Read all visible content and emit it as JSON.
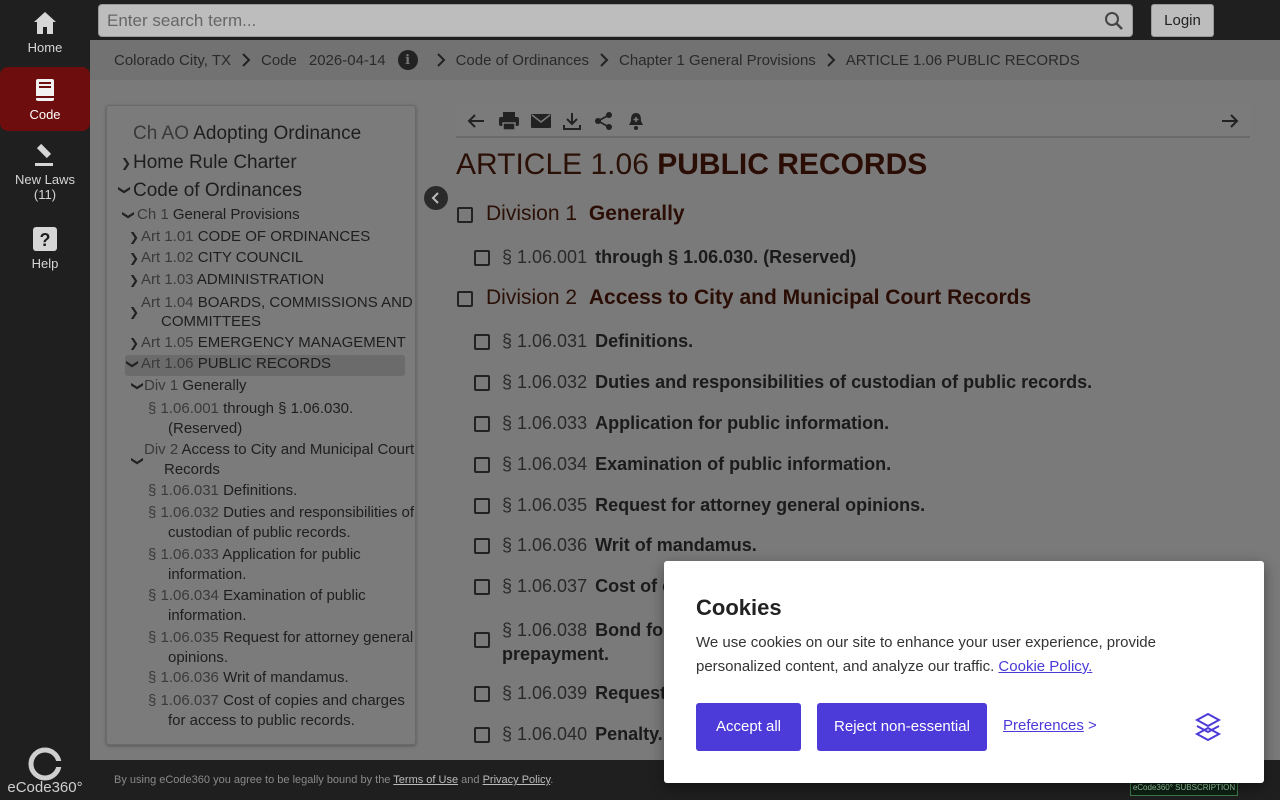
{
  "rail": {
    "home_label": "Home",
    "code_label": "Code",
    "new_laws_label": "New Laws",
    "new_laws_count": "(11)",
    "help_label": "Help",
    "logo_text": "eCode360°"
  },
  "search": {
    "placeholder": "Enter search term...",
    "login_label": "Login"
  },
  "breadcrumb": {
    "items": [
      "Colorado City, TX",
      "Code",
      "Code of Ordinances",
      "Chapter 1 General Provisions",
      "ARTICLE 1.06 PUBLIC RECORDS"
    ],
    "date": "2026-04-14",
    "info_glyph": "i"
  },
  "toc": {
    "ch_ao_pre": "Ch AO",
    "ch_ao_label": "Adopting Ordinance",
    "home_rule": "Home Rule Charter",
    "code_ord": "Code of Ordinances",
    "ch1_pre": "Ch 1",
    "ch1_label": "General Provisions",
    "articles": [
      {
        "pre": "Art 1.01",
        "label": "CODE OF ORDINANCES"
      },
      {
        "pre": "Art 1.02",
        "label": "CITY COUNCIL"
      },
      {
        "pre": "Art 1.03",
        "label": "ADMINISTRATION"
      },
      {
        "pre": "Art 1.04",
        "label": "BOARDS, COMMISSIONS AND",
        "label2": "COMMITTEES"
      },
      {
        "pre": "Art 1.05",
        "label": "EMERGENCY MANAGEMENT"
      },
      {
        "pre": "Art 1.06",
        "label": "PUBLIC RECORDS"
      }
    ],
    "div1_pre": "Div 1",
    "div1_label": "Generally",
    "div1_sec_pre": "§ 1.06.001",
    "div1_sec_label": "through § 1.06.030.",
    "div1_sec_label2": "(Reserved)",
    "div2_pre": "Div 2",
    "div2_label": "Access to City and Municipal Court",
    "div2_label2": "Records",
    "sections": [
      {
        "pre": "§ 1.06.031",
        "label": "Definitions."
      },
      {
        "pre": "§ 1.06.032",
        "label": "Duties and responsibilities of",
        "label2": "custodian of public records."
      },
      {
        "pre": "§ 1.06.033",
        "label": "Application for public",
        "label2": "information."
      },
      {
        "pre": "§ 1.06.034",
        "label": "Examination of public",
        "label2": "information."
      },
      {
        "pre": "§ 1.06.035",
        "label": "Request for attorney general",
        "label2": "opinions."
      },
      {
        "pre": "§ 1.06.036",
        "label": "Writ of mandamus."
      },
      {
        "pre": "§ 1.06.037",
        "label": "Cost of copies and charges",
        "label2": "for access to public records."
      }
    ]
  },
  "main": {
    "title_pre": "ARTICLE 1.06",
    "title": "PUBLIC RECORDS",
    "div1_pre": "Division 1",
    "div1_label": "Generally",
    "div1_sec_pre": "§ 1.06.001",
    "div1_sec_label": "through § 1.06.030. (Reserved)",
    "div2_pre": "Division 2",
    "div2_label": "Access to City and Municipal Court Records",
    "sections": [
      {
        "pre": "§ 1.06.031",
        "label": "Definitions."
      },
      {
        "pre": "§ 1.06.032",
        "label": "Duties and responsibilities of custodian of public records."
      },
      {
        "pre": "§ 1.06.033",
        "label": "Application for public information."
      },
      {
        "pre": "§ 1.06.034",
        "label": "Examination of public information."
      },
      {
        "pre": "§ 1.06.035",
        "label": "Request for attorney general opinions."
      },
      {
        "pre": "§ 1.06.036",
        "label": "Writ of mandamus."
      },
      {
        "pre": "§ 1.06.037",
        "label": "Cost of c"
      },
      {
        "pre": "§ 1.06.038",
        "label": "Bond for",
        "label2": "prepayment."
      },
      {
        "pre": "§ 1.06.039",
        "label": "Requests"
      },
      {
        "pre": "§ 1.06.040",
        "label": "Penalty."
      }
    ]
  },
  "footer": {
    "text_prefix": "By using eCode360 you agree to be legally bound by the",
    "terms": "Terms of Use",
    "and": "and",
    "privacy": "Privacy Policy",
    "period": ".",
    "badge": "eCode360° SUBSCRIPTION"
  },
  "cookie": {
    "title": "Cookies",
    "body": "We use cookies on our site to enhance your user experience, provide personalized content, and analyze our traffic.",
    "policy_link": "Cookie Policy.",
    "accept": "Accept all",
    "reject": "Reject non-essential",
    "preferences": "Preferences",
    "preferences_arrow": ">"
  },
  "colors": {
    "accent": "#4c3ad9",
    "rail_active": "#6e0d0d",
    "heading": "#2a0d04"
  }
}
